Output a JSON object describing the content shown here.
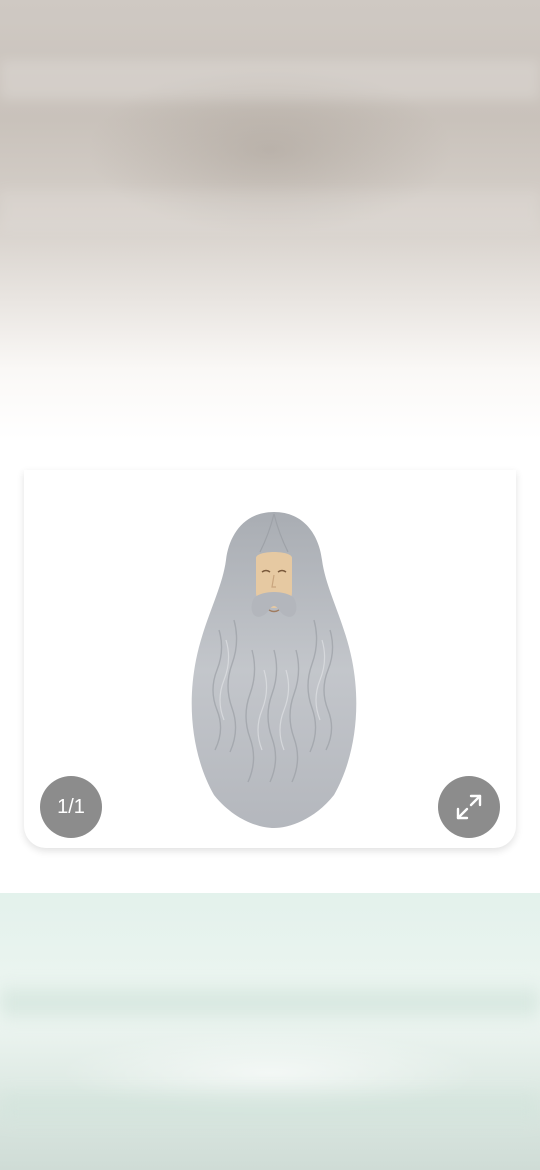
{
  "viewer": {
    "counter_text": "1/1",
    "product_image_icon": "gray-wizard-wig-with-beard",
    "expand_icon": "expand-arrows-icon"
  },
  "colors": {
    "control_bg": "#787878",
    "hair_gray": "#b9bcc2",
    "backdrop_top": "#cfc9c3",
    "backdrop_bottom": "#e3f2ec"
  }
}
